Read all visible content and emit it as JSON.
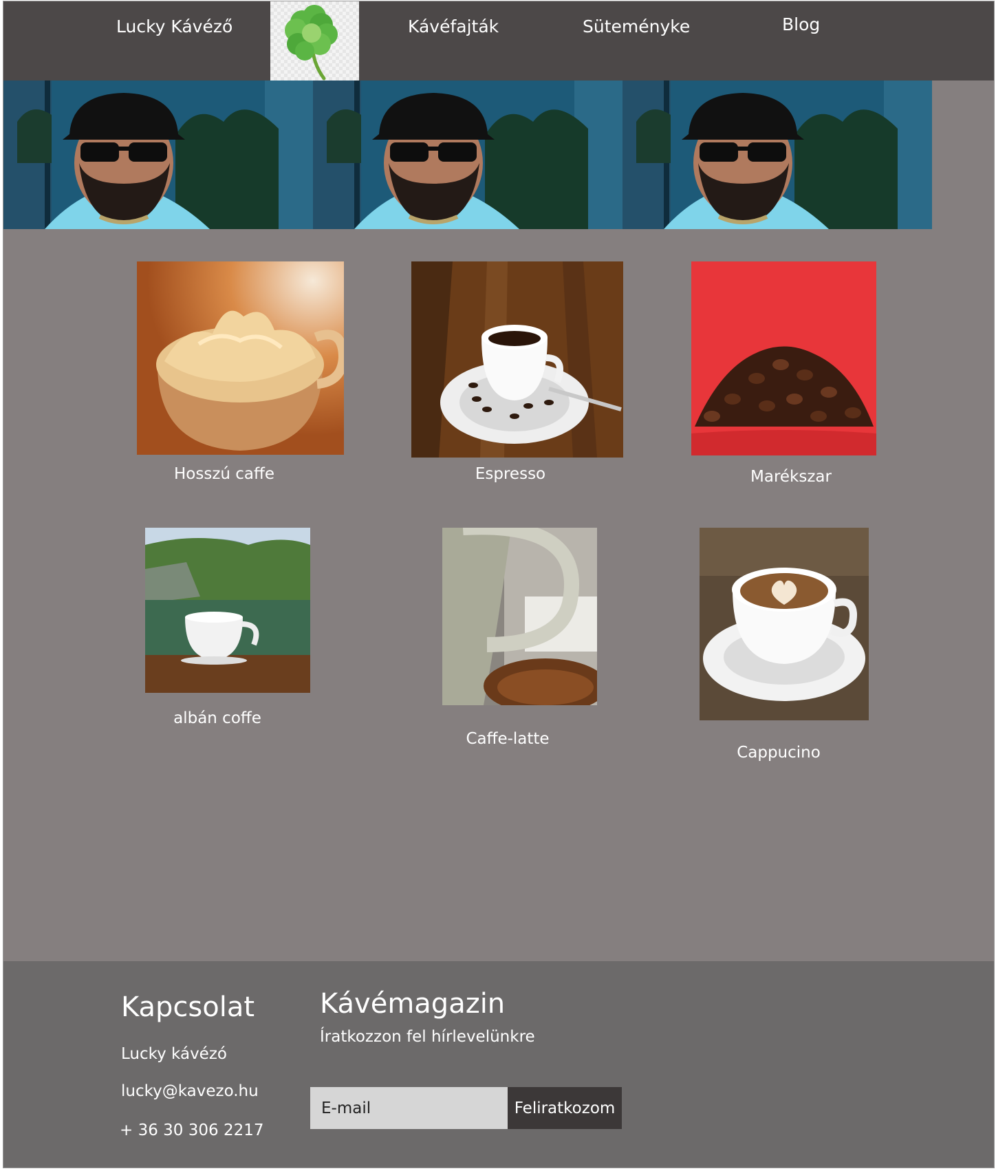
{
  "nav": {
    "items": [
      {
        "label": "Lucky Kávéző"
      },
      {
        "label": "Kávéfajták"
      },
      {
        "label": "Süteményke"
      },
      {
        "label": "Blog"
      }
    ],
    "logo_icon": "clover-icon",
    "background": "#4c4848"
  },
  "hero": {
    "icon": "banner-portrait-image"
  },
  "products": [
    {
      "name": "Hosszú caffe"
    },
    {
      "name": "Espresso"
    },
    {
      "name": "Marékszar"
    },
    {
      "name": "albán coffe"
    },
    {
      "name": "Caffe-latte"
    },
    {
      "name": "Cappucino"
    }
  ],
  "footer": {
    "contact": {
      "title": "Kapcsolat",
      "name": "Lucky kávézó",
      "email": "lucky@kavezo.hu",
      "phone": "+ 36 30 306 2217"
    },
    "newsletter": {
      "title": "Kávémagazin",
      "subtitle": "Íratkozzon fel hírlevelünkre",
      "email_placeholder": "E-mail",
      "button_label": "Feliratkozom"
    }
  },
  "colors": {
    "page_background": "#857f7f",
    "footer_background": "#6c6a6a",
    "button_background": "#3c3838"
  }
}
